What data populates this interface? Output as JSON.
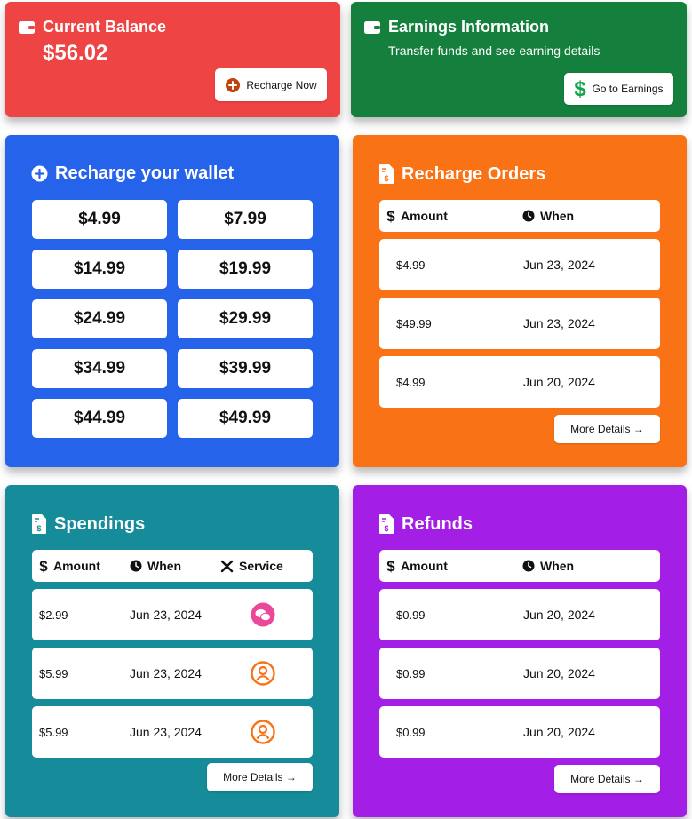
{
  "balance": {
    "title": "Current Balance",
    "value": "$56.02",
    "button_label": "Recharge Now"
  },
  "earnings": {
    "title": "Earnings Information",
    "subtitle": "Transfer funds and see earning details",
    "button_label": "Go to Earnings"
  },
  "recharge_wallet": {
    "title": "Recharge your wallet",
    "amounts": [
      "$4.99",
      "$7.99",
      "$14.99",
      "$19.99",
      "$24.99",
      "$29.99",
      "$34.99",
      "$39.99",
      "$44.99",
      "$49.99"
    ]
  },
  "recharge_orders": {
    "title": "Recharge Orders",
    "headers": {
      "amount": "Amount",
      "when": "When"
    },
    "rows": [
      {
        "amount": "$4.99",
        "when": "Jun 23, 2024"
      },
      {
        "amount": "$49.99",
        "when": "Jun 23, 2024"
      },
      {
        "amount": "$4.99",
        "when": "Jun 20, 2024"
      }
    ],
    "more_label": "More Details →"
  },
  "spendings": {
    "title": "Spendings",
    "headers": {
      "amount": "Amount",
      "when": "When",
      "service": "Service"
    },
    "rows": [
      {
        "amount": "$2.99",
        "when": "Jun 23, 2024",
        "service_icon": "chat-bubbles-icon"
      },
      {
        "amount": "$5.99",
        "when": "Jun 23, 2024",
        "service_icon": "user-circle-icon"
      },
      {
        "amount": "$5.99",
        "when": "Jun 23, 2024",
        "service_icon": "user-circle-icon"
      }
    ],
    "more_label": "More Details →"
  },
  "refunds": {
    "title": "Refunds",
    "headers": {
      "amount": "Amount",
      "when": "When"
    },
    "rows": [
      {
        "amount": "$0.99",
        "when": "Jun 20, 2024"
      },
      {
        "amount": "$0.99",
        "when": "Jun 20, 2024"
      },
      {
        "amount": "$0.99",
        "when": "Jun 20, 2024"
      }
    ],
    "more_label": "More Details →"
  },
  "colors": {
    "balance": "#ef4444",
    "earnings": "#15803d",
    "wallet": "#2563eb",
    "orders": "#f97316",
    "spendings": "#168b9a",
    "refunds": "#a31fe6",
    "chat_icon": "#ec4899",
    "user_icon": "#f97316",
    "earnings_dollar": "#16a34a"
  }
}
